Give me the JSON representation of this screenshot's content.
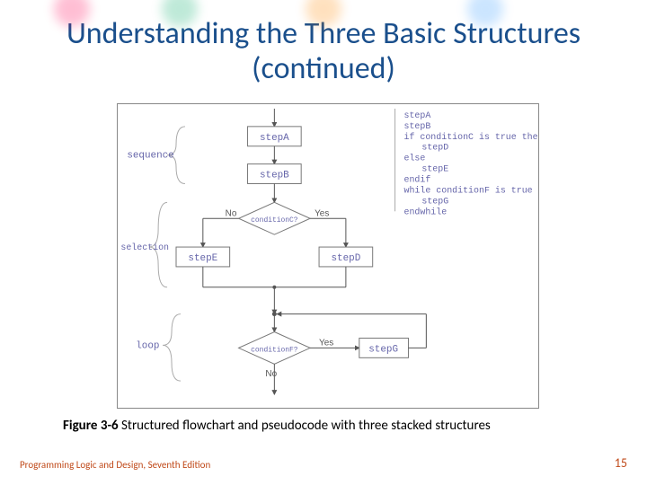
{
  "title": "Understanding the Three Basic Structures (continued)",
  "caption": {
    "label": "Figure 3-6",
    "text": "Structured flowchart and pseudocode with three stacked structures"
  },
  "footer": {
    "left": "Programming Logic and Design, Seventh Edition",
    "page": "15"
  },
  "flowchart": {
    "labels": {
      "sequence": "sequence",
      "selection": "selection",
      "loop": "loop"
    },
    "steps": {
      "A": "stepA",
      "B": "stepB",
      "D": "stepD",
      "E": "stepE",
      "G": "stepG"
    },
    "conditions": {
      "C": "conditionC?",
      "F": "conditionF?"
    },
    "edges": {
      "yes": "Yes",
      "no": "No"
    }
  },
  "pseudocode": {
    "l1": "stepA",
    "l2": "stepB",
    "l3": "if conditionC is true then",
    "l4": "stepD",
    "l5": "else",
    "l6": "stepE",
    "l7": "endif",
    "l8": "while conditionF is true",
    "l9": "stepG",
    "l10": "endwhile"
  }
}
